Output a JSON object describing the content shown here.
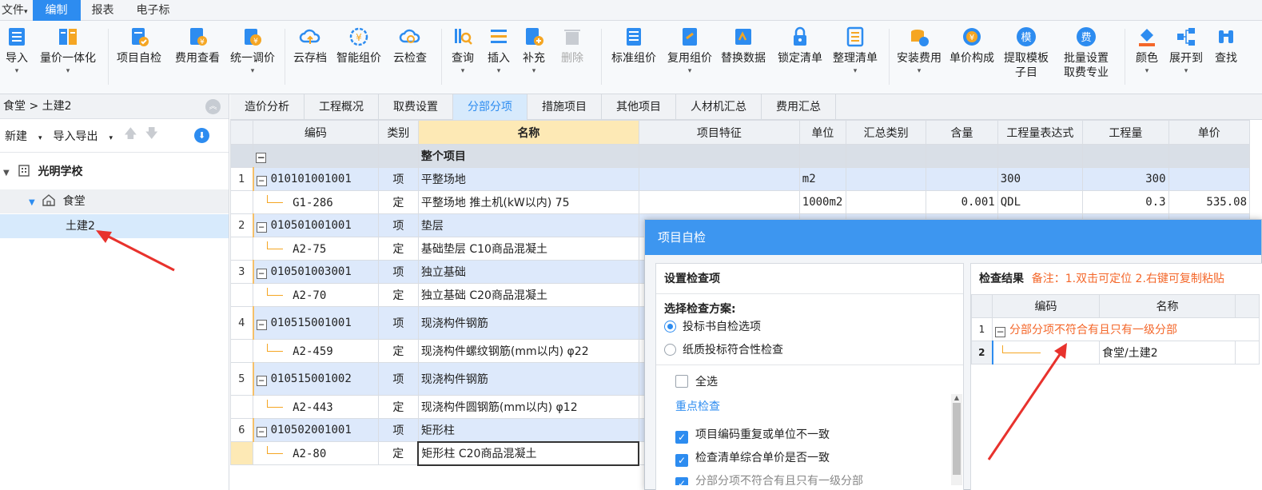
{
  "menu": {
    "file": "文件",
    "tabs": [
      "编制",
      "报表",
      "电子标"
    ],
    "active_tab": "编制"
  },
  "toolbar": {
    "import": "导入",
    "price_integration": "量价一体化",
    "self_check": "项目自检",
    "fee_view": "费用查看",
    "unified_adjust": "统一调价",
    "cloud_save": "云存档",
    "smart_price": "智能组价",
    "cloud_check": "云检查",
    "query": "查询",
    "insert": "插入",
    "supplement": "补充",
    "delete": "删除",
    "standard_price": "标准组价",
    "reuse_price": "复用组价",
    "replace_data": "替换数据",
    "lock_list": "锁定清单",
    "tidy_list": "整理清单",
    "install_fee": "安装费用",
    "unit_price_comp": "单价构成",
    "extract_template_1": "提取模板",
    "extract_template_2": "子目",
    "batch_set_1": "批量设置",
    "batch_set_2": "取费专业",
    "color": "颜色",
    "expand_to": "展开到",
    "find": "查找"
  },
  "left": {
    "breadcrumb": "食堂 > 土建2",
    "new": "新建",
    "import_export": "导入导出",
    "tree": {
      "root": "光明学校",
      "child": "食堂",
      "leaf": "土建2"
    }
  },
  "tabs": [
    "造价分析",
    "工程概况",
    "取费设置",
    "分部分项",
    "措施项目",
    "其他项目",
    "人材机汇总",
    "费用汇总"
  ],
  "active_tab": "分部分项",
  "grid": {
    "headers": [
      "编码",
      "类别",
      "名称",
      "项目特征",
      "单位",
      "汇总类别",
      "含量",
      "工程量表达式",
      "工程量",
      "单价"
    ],
    "whole_label": "整个项目",
    "rows": [
      {
        "type": "qd",
        "no": "1",
        "code": "010101001001",
        "cat": "项",
        "name": "平整场地",
        "unit": "m2",
        "content": "",
        "expr": "300",
        "qty": "300",
        "price": ""
      },
      {
        "type": "de",
        "no": "",
        "code": "G1-286",
        "cat": "定",
        "name": "平整场地 推土机(kW以内) 75",
        "unit": "1000m2",
        "content": "0.001",
        "expr": "QDL",
        "qty": "0.3",
        "price": "535.08"
      },
      {
        "type": "qd",
        "no": "2",
        "code": "010501001001",
        "cat": "项",
        "name": "垫层",
        "unit": "",
        "content": "",
        "expr": "",
        "qty": "",
        "price": ""
      },
      {
        "type": "de",
        "no": "",
        "code": "A2-75",
        "cat": "定",
        "name": "基础垫层 C10商品混凝土",
        "unit": "",
        "content": "",
        "expr": "",
        "qty": "",
        "price": ""
      },
      {
        "type": "qd",
        "no": "3",
        "code": "010501003001",
        "cat": "项",
        "name": "独立基础",
        "unit": "",
        "content": "",
        "expr": "",
        "qty": "",
        "price": ""
      },
      {
        "type": "de",
        "no": "",
        "code": "A2-70",
        "cat": "定",
        "name": "独立基础 C20商品混凝土",
        "unit": "",
        "content": "",
        "expr": "",
        "qty": "",
        "price": ""
      },
      {
        "type": "qd",
        "no": "4",
        "code": "010515001001",
        "cat": "项",
        "name": "现浇构件钢筋",
        "unit": "",
        "content": "",
        "expr": "",
        "qty": "",
        "price": ""
      },
      {
        "type": "de",
        "no": "",
        "code": "A2-459",
        "cat": "定",
        "name": "现浇构件螺纹钢筋(mm以内) φ22",
        "unit": "",
        "content": "",
        "expr": "",
        "qty": "",
        "price": ""
      },
      {
        "type": "qd",
        "no": "5",
        "code": "010515001002",
        "cat": "项",
        "name": "现浇构件钢筋",
        "unit": "",
        "content": "",
        "expr": "",
        "qty": "",
        "price": ""
      },
      {
        "type": "de",
        "no": "",
        "code": "A2-443",
        "cat": "定",
        "name": "现浇构件圆钢筋(mm以内) φ12",
        "unit": "",
        "content": "",
        "expr": "",
        "qty": "",
        "price": ""
      },
      {
        "type": "qd",
        "no": "6",
        "code": "010502001001",
        "cat": "项",
        "name": "矩形柱",
        "unit": "",
        "content": "",
        "expr": "",
        "qty": "",
        "price": ""
      },
      {
        "type": "de",
        "no": "",
        "code": "A2-80",
        "cat": "定",
        "name": "矩形柱 C20商品混凝土",
        "unit": "",
        "content": "",
        "expr": "",
        "qty": "",
        "price": ""
      }
    ]
  },
  "dialog": {
    "title": "项目自检",
    "settings_title": "设置检查项",
    "scheme_label": "选择检查方案:",
    "scheme_options": [
      "投标书自检选项",
      "纸质投标符合性检查"
    ],
    "select_all": "全选",
    "key_check": "重点检查",
    "checks": [
      "项目编码重复或单位不一致",
      "检查清单综合单价是否一致",
      "分部分项不符合有且只有一级分部"
    ],
    "result_title": "检查结果",
    "result_note": "备注：1.双击可定位 2.右键可复制粘贴",
    "result_headers": [
      "编码",
      "名称"
    ],
    "result_rows": [
      {
        "no": "1",
        "text": "分部分项不符合有且只有一级分部"
      },
      {
        "no": "2",
        "name": "食堂/土建2"
      }
    ]
  }
}
